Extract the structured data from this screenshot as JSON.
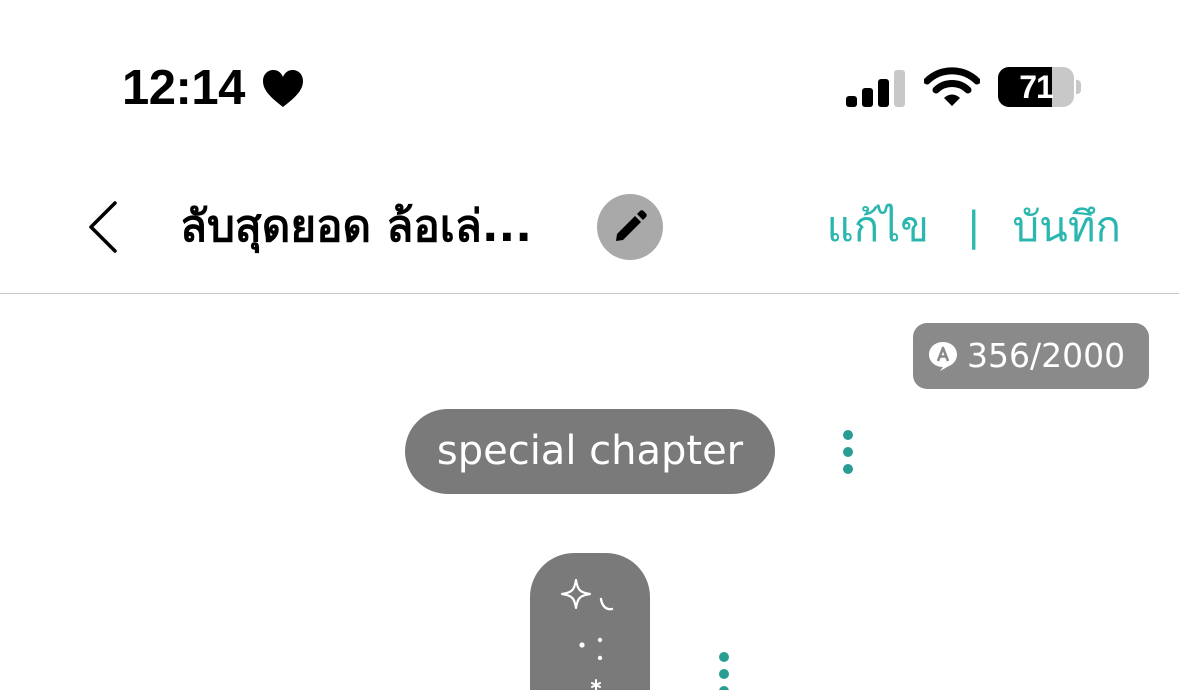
{
  "status_bar": {
    "time": "12:14",
    "battery_level": "71",
    "battery_fraction": 0.71
  },
  "nav": {
    "title": "ลับสุดยอด ล้อเล่...",
    "edit_label": "แก้ไข",
    "separator": "|",
    "save_label": "บันทึก"
  },
  "counter": {
    "text": "356/2000"
  },
  "chapter": {
    "label": "special chapter"
  },
  "colors": {
    "accent": "#2bb7b0",
    "pill_bg": "#7a7a7a",
    "counter_bg": "#8a8a8a",
    "more_dots": "#2a9d92"
  },
  "icons": {
    "back": "chevron-left-icon",
    "edit_title": "pencil-icon",
    "counter": "font-a-bubble-icon",
    "more": "vertical-dots-icon",
    "status_heart": "heart-icon"
  }
}
